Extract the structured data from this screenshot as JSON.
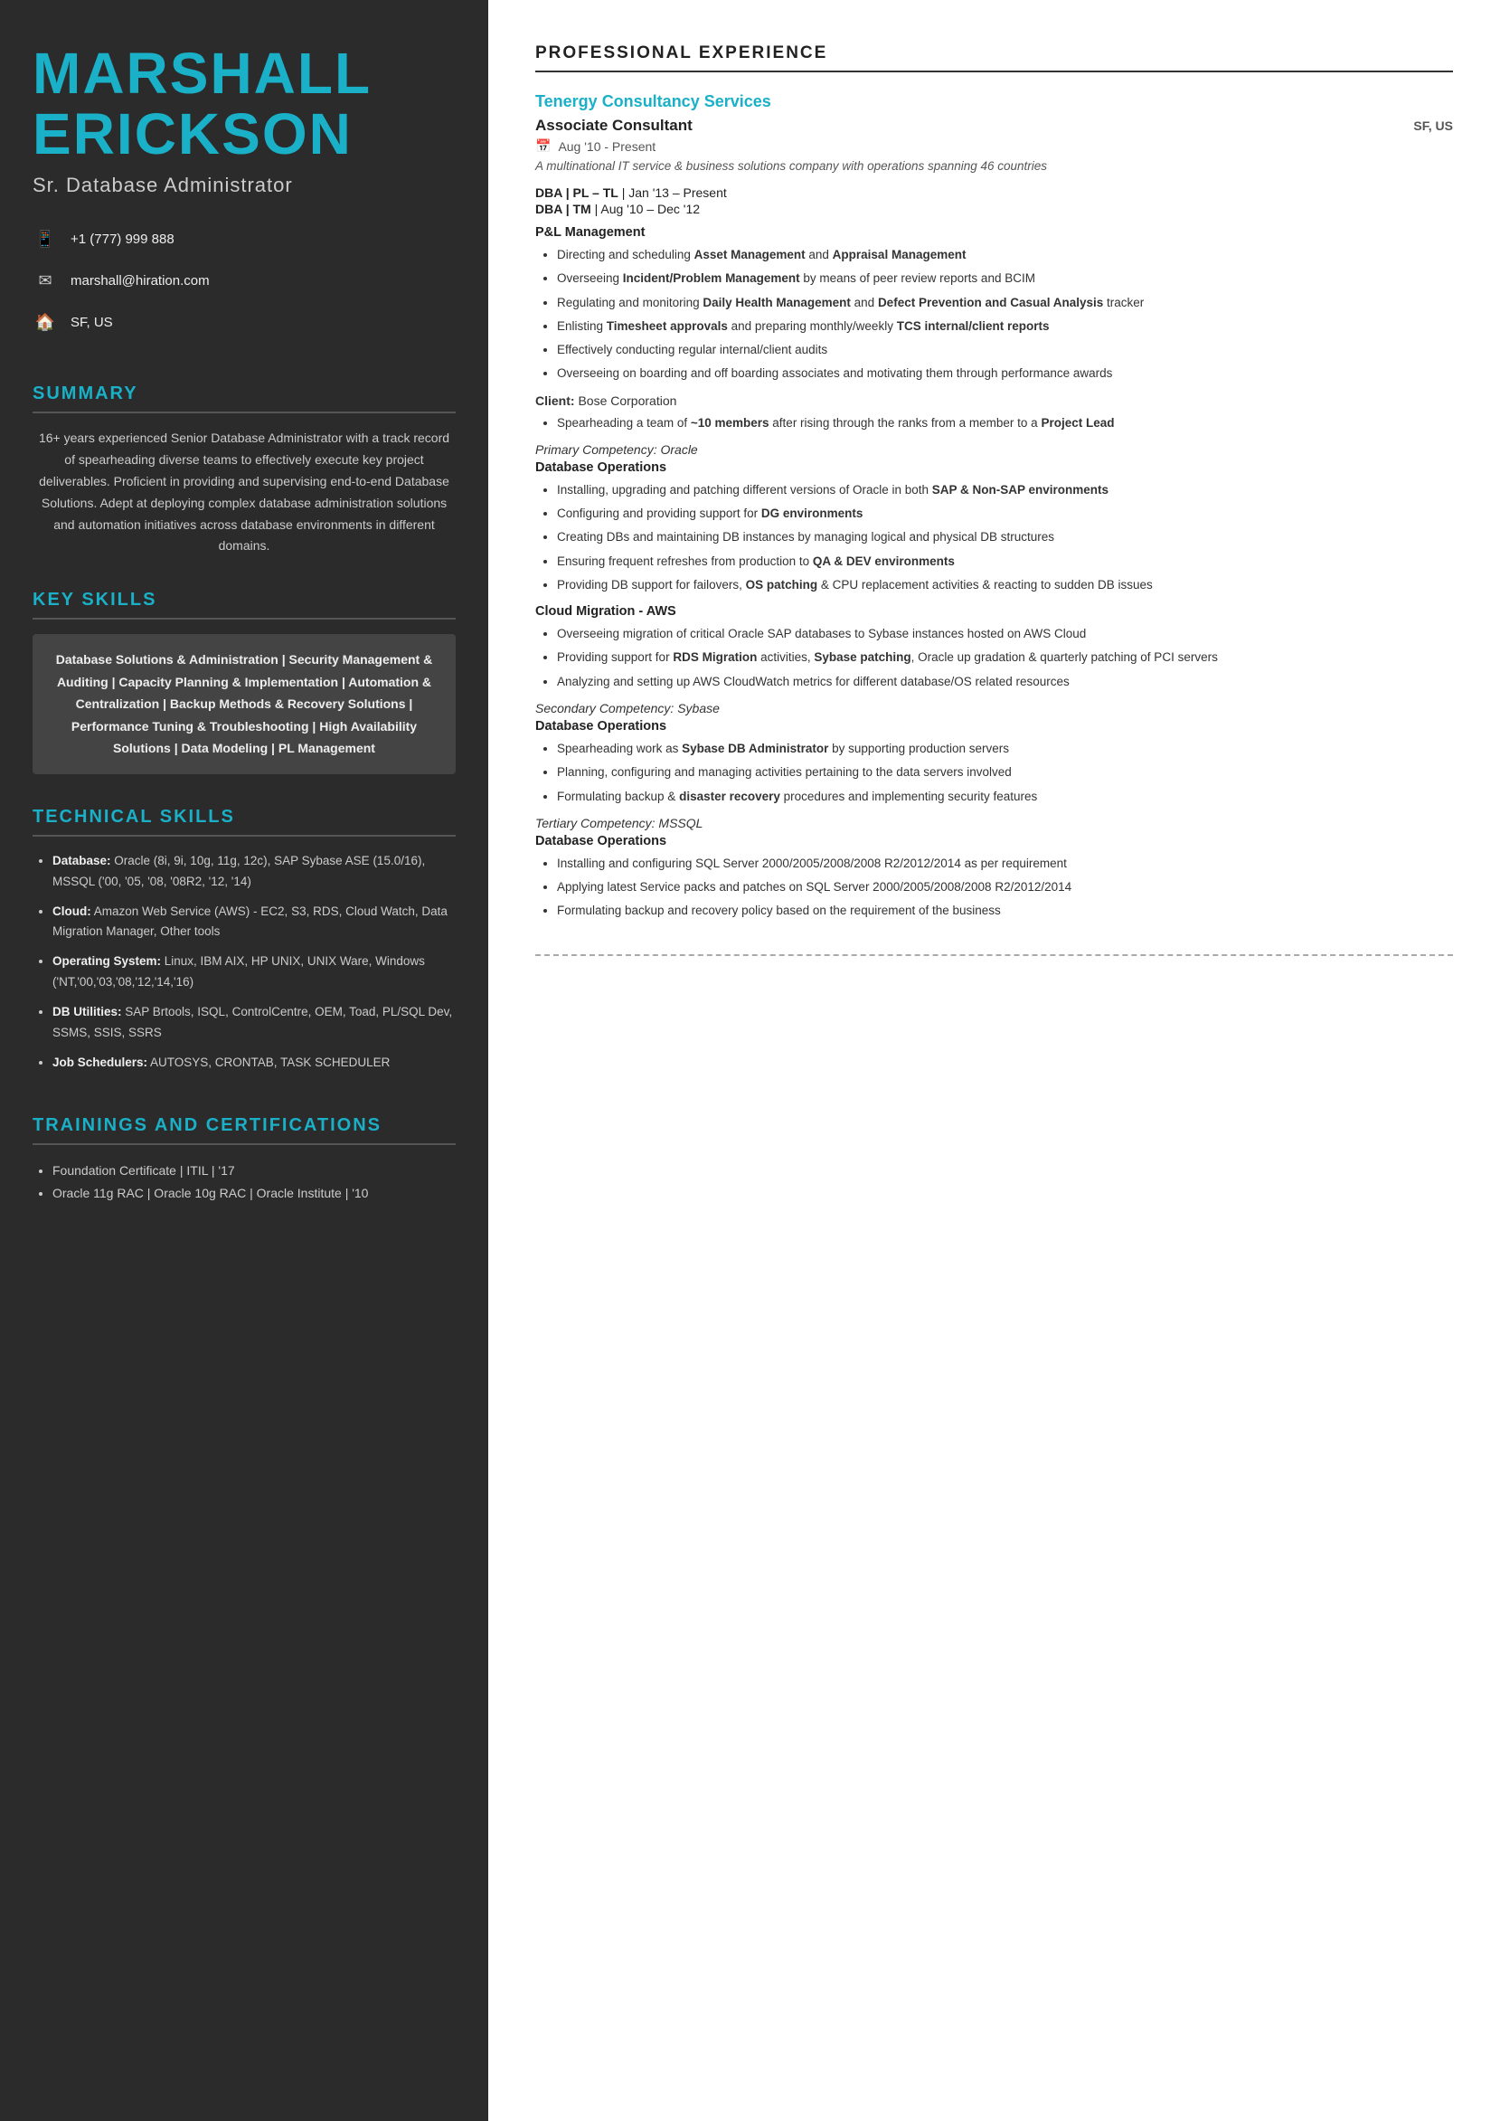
{
  "sidebar": {
    "name_line1": "MARSHALL",
    "name_line2": "ERICKSON",
    "title": "Sr. Database Administrator",
    "contact": {
      "phone_icon": "📱",
      "phone": "+1 (777) 999 888",
      "email_icon": "✉",
      "email": "marshall@hiration.com",
      "location_icon": "🏠",
      "location": "SF, US"
    },
    "summary_title": "SUMMARY",
    "summary": "16+ years experienced Senior Database Administrator with a track record of spearheading diverse teams to effectively execute key project deliverables. Proficient in providing and supervising end-to-end Database Solutions. Adept at deploying complex database administration solutions and automation initiatives across database environments in different domains.",
    "key_skills_title": "KEY SKILLS",
    "key_skills_text": "Database Solutions & Administration | Security Management & Auditing | Capacity Planning & Implementation | Automation & Centralization | Backup Methods & Recovery Solutions | Performance Tuning & Troubleshooting | High Availability Solutions | Data Modeling | PL Management",
    "technical_skills_title": "TECHNICAL SKILLS",
    "technical_skills": [
      {
        "label": "Database:",
        "value": "Oracle (8i, 9i, 10g, 11g, 12c), SAP Sybase ASE (15.0/16), MSSQL ('00, '05, '08, '08R2, '12, '14)"
      },
      {
        "label": "Cloud:",
        "value": "Amazon Web Service (AWS) - EC2, S3, RDS, Cloud Watch, Data Migration Manager, Other tools"
      },
      {
        "label": "Operating System:",
        "value": "Linux, IBM AIX, HP UNIX, UNIX Ware, Windows ('NT,'00,'03,'08,'12,'14,'16)"
      },
      {
        "label": "DB Utilities:",
        "value": "SAP Brtools, ISQL, ControlCentre, OEM, Toad, PL/SQL Dev, SSMS, SSIS, SSRS"
      },
      {
        "label": "Job Schedulers:",
        "value": "AUTOSYS, CRONTAB, TASK SCHEDULER"
      }
    ],
    "trainings_title": "TRAININGS AND CERTIFICATIONS",
    "certifications": [
      "Foundation Certificate  |  ITIL  |  '17",
      "Oracle 11g RAC  |  Oracle 10g RAC  |  Oracle Institute  |  '10"
    ]
  },
  "main": {
    "professional_experience_title": "PROFESSIONAL EXPERIENCE",
    "company": "Tenergy Consultancy Services",
    "job_title": "Associate Consultant",
    "job_location": "SF, US",
    "date_icon": "📅",
    "date_range": "Aug '10  -  Present",
    "company_desc": "A multinational IT service & business solutions company with operations spanning 46 countries",
    "roles": [
      {
        "label": "DBA | PL – TL",
        "dates": "Jan '13 – Present"
      },
      {
        "label": "DBA | TM",
        "dates": "Aug '10 – Dec '12"
      }
    ],
    "pl_heading": "P&L Management",
    "pl_bullets": [
      {
        "text": "Directing and scheduling ",
        "bold": "Asset Management",
        "rest": " and ",
        "bold2": "Appraisal Management",
        "rest2": ""
      },
      {
        "text": "Overseeing ",
        "bold": "Incident/Problem Management",
        "rest": " by means of peer review reports and BCIM"
      },
      {
        "text": "Regulating and monitoring ",
        "bold": "Daily Health Management",
        "rest": " and ",
        "bold2": "Defect Prevention and Casual Analysis",
        "rest2": " tracker"
      },
      {
        "text": "Enlisting ",
        "bold": "Timesheet approvals",
        "rest": " and preparing monthly/weekly ",
        "bold2": "TCS internal/client reports",
        "rest2": ""
      },
      {
        "text": "Effectively conducting regular internal/client audits"
      },
      {
        "text": "Overseeing on boarding and off boarding associates and motivating them through performance awards"
      }
    ],
    "client_label": "Client:",
    "client_name": "Bose Corporation",
    "client_bullets": [
      {
        "text": "Spearheading a team of ",
        "bold": "~10 members",
        "rest": " after rising through the ranks from a member to a ",
        "bold2": "Project Lead",
        "rest2": ""
      }
    ],
    "primary_competency_label": "Primary Competency:",
    "primary_competency_value": "Oracle",
    "db_ops_heading": "Database Operations",
    "oracle_bullets": [
      {
        "text": "Installing, upgrading and patching different versions of Oracle in both ",
        "bold": "SAP & Non-SAP environments",
        "rest": ""
      },
      {
        "text": "Configuring and providing support for ",
        "bold": "DG environments",
        "rest": ""
      },
      {
        "text": "Creating DBs and maintaining DB instances by managing logical and physical DB structures"
      },
      {
        "text": "Ensuring frequent refreshes from production to ",
        "bold": "QA & DEV environments",
        "rest": ""
      },
      {
        "text": "Providing DB support for failovers, ",
        "bold": "OS patching",
        "rest": " & CPU replacement activities & reacting to sudden DB issues"
      }
    ],
    "cloud_heading": "Cloud Migration - AWS",
    "aws_bullets": [
      {
        "text": "Overseeing migration of critical Oracle SAP databases to Sybase instances hosted on AWS Cloud"
      },
      {
        "text": "Providing support for ",
        "bold": "RDS Migration",
        "rest": " activities, ",
        "bold2": "Sybase patching",
        "rest2": ", Oracle up gradation & quarterly patching of PCI servers"
      },
      {
        "text": "Analyzing and setting up AWS CloudWatch metrics for different database/OS related resources"
      }
    ],
    "secondary_competency_label": "Secondary Competency:",
    "secondary_competency_value": "Sybase",
    "sybase_ops_heading": "Database Operations",
    "sybase_bullets": [
      {
        "text": "Spearheading work as ",
        "bold": "Sybase DB Administrator",
        "rest": " by supporting production servers"
      },
      {
        "text": "Planning, configuring and managing activities pertaining to the data servers involved"
      },
      {
        "text": "Formulating backup & ",
        "bold": "disaster recovery",
        "rest": " procedures and implementing security features"
      }
    ],
    "tertiary_competency_label": "Tertiary Competency:",
    "tertiary_competency_value": "MSSQL",
    "mssql_ops_heading": "Database Operations",
    "mssql_bullets": [
      {
        "text": "Installing and configuring SQL Server 2000/2005/2008/2008 R2/2012/2014 as per requirement"
      },
      {
        "text": "Applying latest Service packs and patches on SQL Server 2000/2005/2008/2008 R2/2012/2014"
      },
      {
        "text": "Formulating backup and recovery policy based on the requirement of the business"
      }
    ]
  }
}
